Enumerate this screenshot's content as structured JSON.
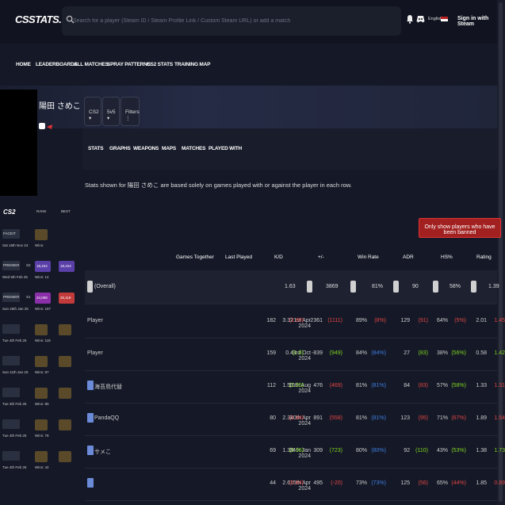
{
  "header": {
    "logo": "CSSTATS.GG",
    "search_placeholder": "Search for a player (Steam ID / Steam Profile Link / Custom Steam URL) or add a match",
    "language": "English",
    "sign_in": "Sign in with Steam"
  },
  "nav": [
    "HOME",
    "LEADERBOARDS",
    "ALL MATCHES",
    "SPRAY PATTERNS",
    "CS2 STATS",
    "TRAINING MAP"
  ],
  "player": {
    "name": "陽田 さめこ"
  },
  "filters": {
    "game": "CS2",
    "mode": "5v5",
    "filters_label": "Filters"
  },
  "tabs": [
    "STATS",
    "GRAPHS",
    "WEAPONS",
    "MAPS",
    "MATCHES",
    "PLAYED WITH"
  ],
  "notice": "Stats shown for 陽田 さめこ are based solely on games played with or against the player in each row.",
  "banned_button": "Only show players who have been banned",
  "columns": [
    "Games Together",
    "Last Played",
    "K/D",
    "+/-",
    "Win Rate",
    "ADR",
    "HS%",
    "Rating"
  ],
  "overall": {
    "name": "(Overall)",
    "kd": "1.63",
    "pm": "3869",
    "win": "81%",
    "adr": "90",
    "hs": "58%",
    "rating": "1.39"
  },
  "rows": [
    {
      "name": "Player",
      "games": "182",
      "last": "21st Apr 2024",
      "kd": "3.32",
      "kd_d": "(1.89)",
      "pm": "2361",
      "pm_d": "(1111)",
      "win": "89%",
      "win_d": "(8%)",
      "adr": "129",
      "adr_d": "(91)",
      "hs": "64%",
      "hs_d": "(5%)",
      "rating": "2.01",
      "rating_d": "1.45"
    },
    {
      "name": "Player",
      "games": "159",
      "last": "3rd Oct 2024",
      "kd": "0.4",
      "kd_d": "(1.8)",
      "pm": "-839",
      "pm_d": "(949)",
      "win": "84%",
      "win_d": "(84%)",
      "adr": "27",
      "adr_d": "(83)",
      "hs": "38%",
      "hs_d": "(56%)",
      "rating": "0.58",
      "rating_d": "1.42"
    },
    {
      "name": "海苔鳥代替",
      "games": "112",
      "last": "16th Aug 2024",
      "kd": "1.53",
      "kd_d": "(1.55)",
      "pm": "476",
      "pm_d": "(469)",
      "win": "81%",
      "win_d": "(81%)",
      "adr": "84",
      "adr_d": "(83)",
      "hs": "57%",
      "hs_d": "(58%)",
      "rating": "1.33",
      "rating_d": "1.31"
    },
    {
      "name": "PandaQQ",
      "games": "80",
      "last": "20th Apr 2024",
      "kd": "2.34",
      "kd_d": "(1.94)",
      "pm": "891",
      "pm_d": "(558)",
      "win": "81%",
      "win_d": "(81%)",
      "adr": "123",
      "adr_d": "(95)",
      "hs": "71%",
      "hs_d": "(67%)",
      "rating": "1.89",
      "rating_d": "1.54"
    },
    {
      "name": "サメこ",
      "games": "69",
      "last": "24th Jan 2024",
      "kd": "1.39",
      "kd_d": "(2.06)",
      "pm": "309",
      "pm_d": "(723)",
      "win": "80%",
      "win_d": "(80%)",
      "adr": "92",
      "adr_d": "(110)",
      "hs": "43%",
      "hs_d": "(53%)",
      "rating": "1.38",
      "rating_d": "1.73"
    },
    {
      "name": "",
      "games": "44",
      "last": "5th Apr 2024",
      "kd": "2.61",
      "kd_d": "(0.84)",
      "pm": "495",
      "pm_d": "(-20)",
      "win": "73%",
      "win_d": "(73%)",
      "adr": "125",
      "adr_d": "(56)",
      "hs": "65%",
      "hs_d": "(44%)",
      "rating": "1.85",
      "rating_d": "0.89"
    }
  ],
  "sidebar": {
    "logo": "CS2",
    "col_rank": "RANK",
    "col_best": "BEST",
    "items": [
      {
        "label": "FACEIT",
        "date": "Sat 16th Nov 24",
        "wins": "Wins:"
      },
      {
        "label": "PREMIER",
        "date": "Wed 5th Feb 25",
        "season": "S2",
        "rank": "18,424",
        "wins": "Wins: 14",
        "best": "18,424"
      },
      {
        "label": "PREMIER",
        "date": "Sun 26th Jan 25",
        "season": "S1",
        "rank": "24,089",
        "wins": "Wins: 187",
        "best": "25,119"
      },
      {
        "label": "",
        "date": "Tue 4th Feb 25",
        "wins": "Wins: 118"
      },
      {
        "label": "",
        "date": "Sun 11th Jan 25",
        "wins": "Wins: 97"
      },
      {
        "label": "",
        "date": "Tue 4th Feb 25",
        "wins": "Wins: 80"
      },
      {
        "label": "",
        "date": "Tue 4th Feb 25",
        "wins": "Wins: 78"
      },
      {
        "label": "",
        "date": "Tue 4th Feb 25",
        "wins": "Wins: 42"
      }
    ]
  },
  "colors": {
    "bg": "#151927",
    "topbar": "#111420",
    "neg": "#e14444",
    "pos": "#7ed321",
    "neu": "#3d7ee0",
    "banned": "#a32020"
  }
}
